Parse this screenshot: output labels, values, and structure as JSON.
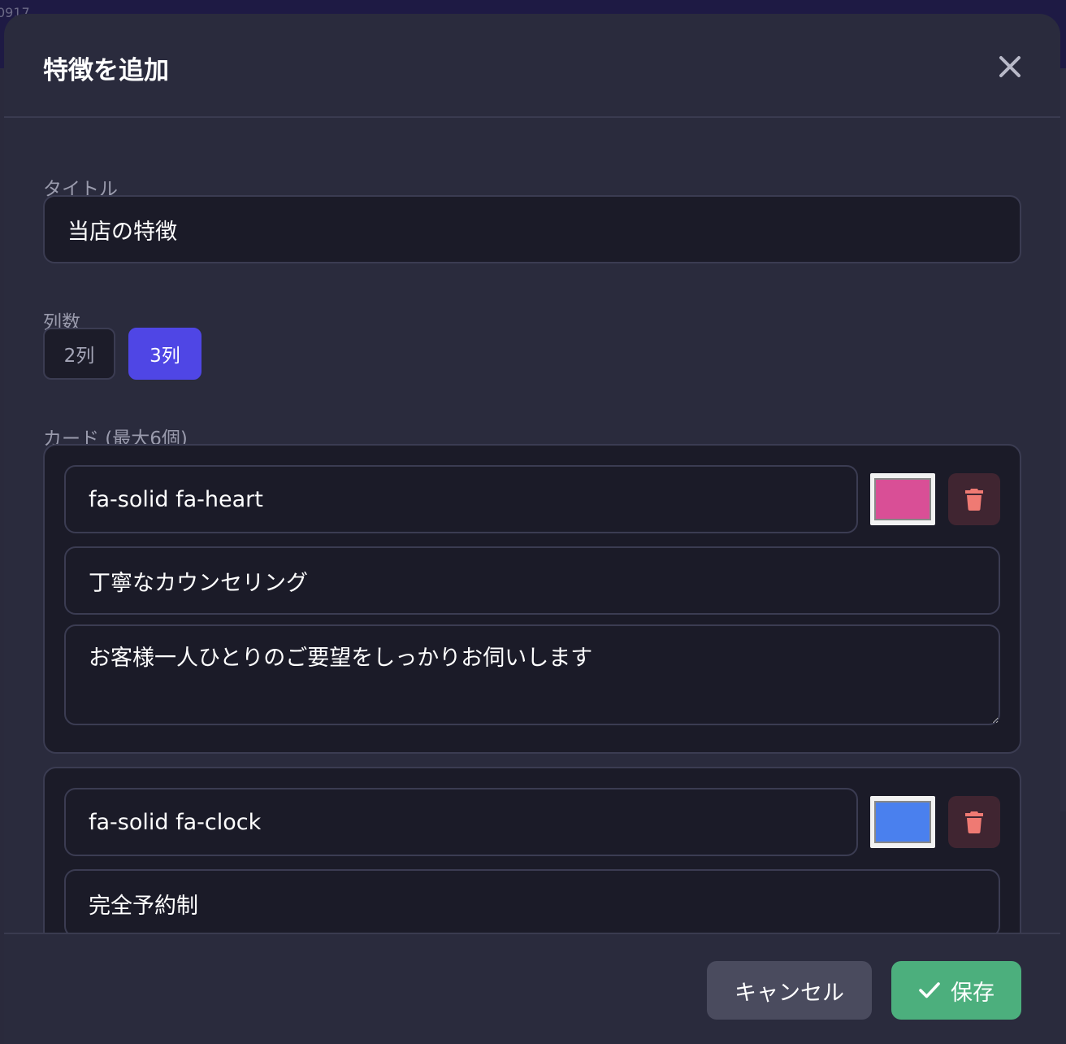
{
  "background": {
    "corner_text": "0917"
  },
  "modal": {
    "title": "特徴を追加",
    "title_field": {
      "label": "タイトル",
      "value": "当店の特徴"
    },
    "columns": {
      "label": "列数",
      "options": [
        {
          "label": "2列",
          "selected": false
        },
        {
          "label": "3列",
          "selected": true
        }
      ]
    },
    "cards_section": {
      "label": "カード (最大6個)",
      "cards": [
        {
          "icon_class": "fa-solid fa-heart",
          "color": "#d94f96",
          "title": "丁寧なカウンセリング",
          "description": "お客様一人ひとりのご要望をしっかりお伺いします"
        },
        {
          "icon_class": "fa-solid fa-clock",
          "color": "#4a80ee",
          "title": "完全予約制",
          "description": ""
        }
      ]
    },
    "footer": {
      "cancel_label": "キャンセル",
      "save_label": "保存"
    }
  },
  "colors": {
    "accent": "#4f46e5",
    "save": "#4caf7d",
    "delete_icon": "#ef7a73"
  }
}
